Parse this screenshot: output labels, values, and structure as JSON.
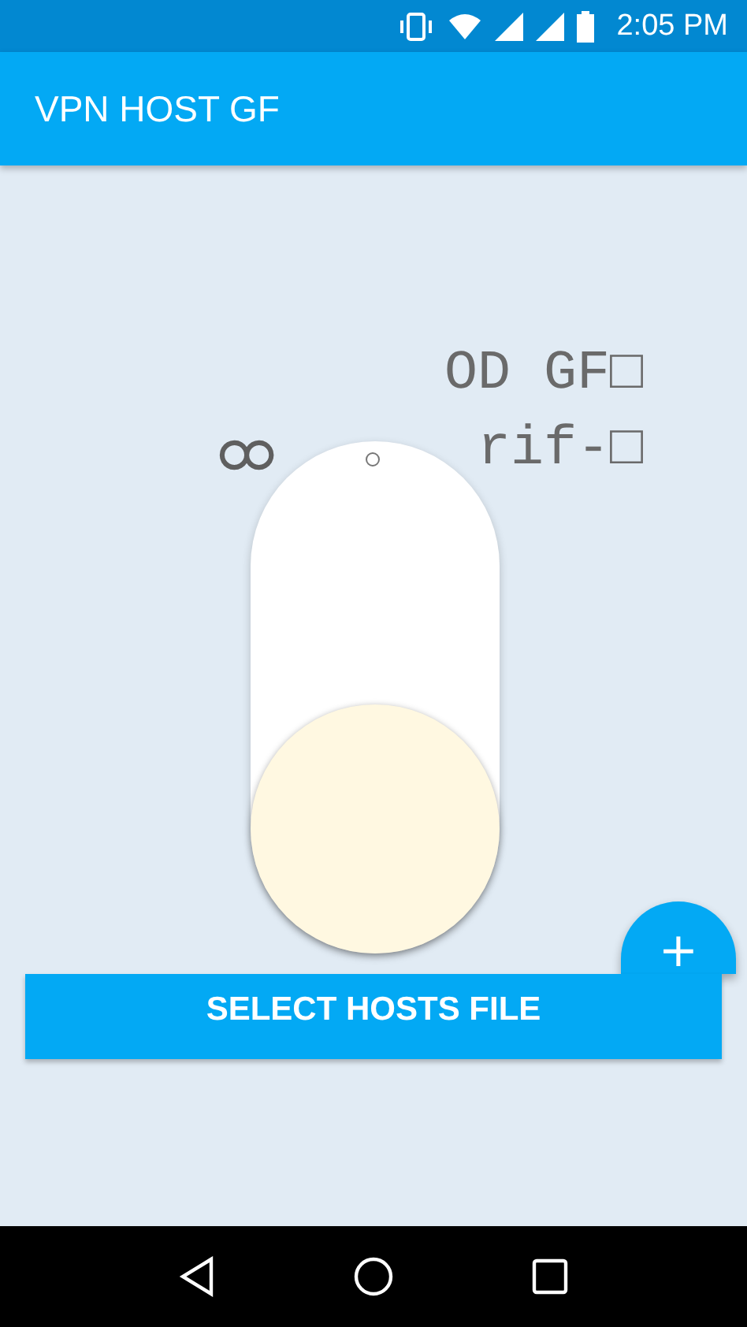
{
  "status_bar": {
    "time": "2:05 PM"
  },
  "app_bar": {
    "title": "VPN HOST GF"
  },
  "sample_text": {
    "line_1": "OD GF□",
    "glyph": "ထ",
    "line_2": "rif-□"
  },
  "toggle": {
    "on": false
  },
  "select_button": {
    "label": "SELECT HOSTS FILE"
  },
  "fab": {
    "label": "+"
  }
}
